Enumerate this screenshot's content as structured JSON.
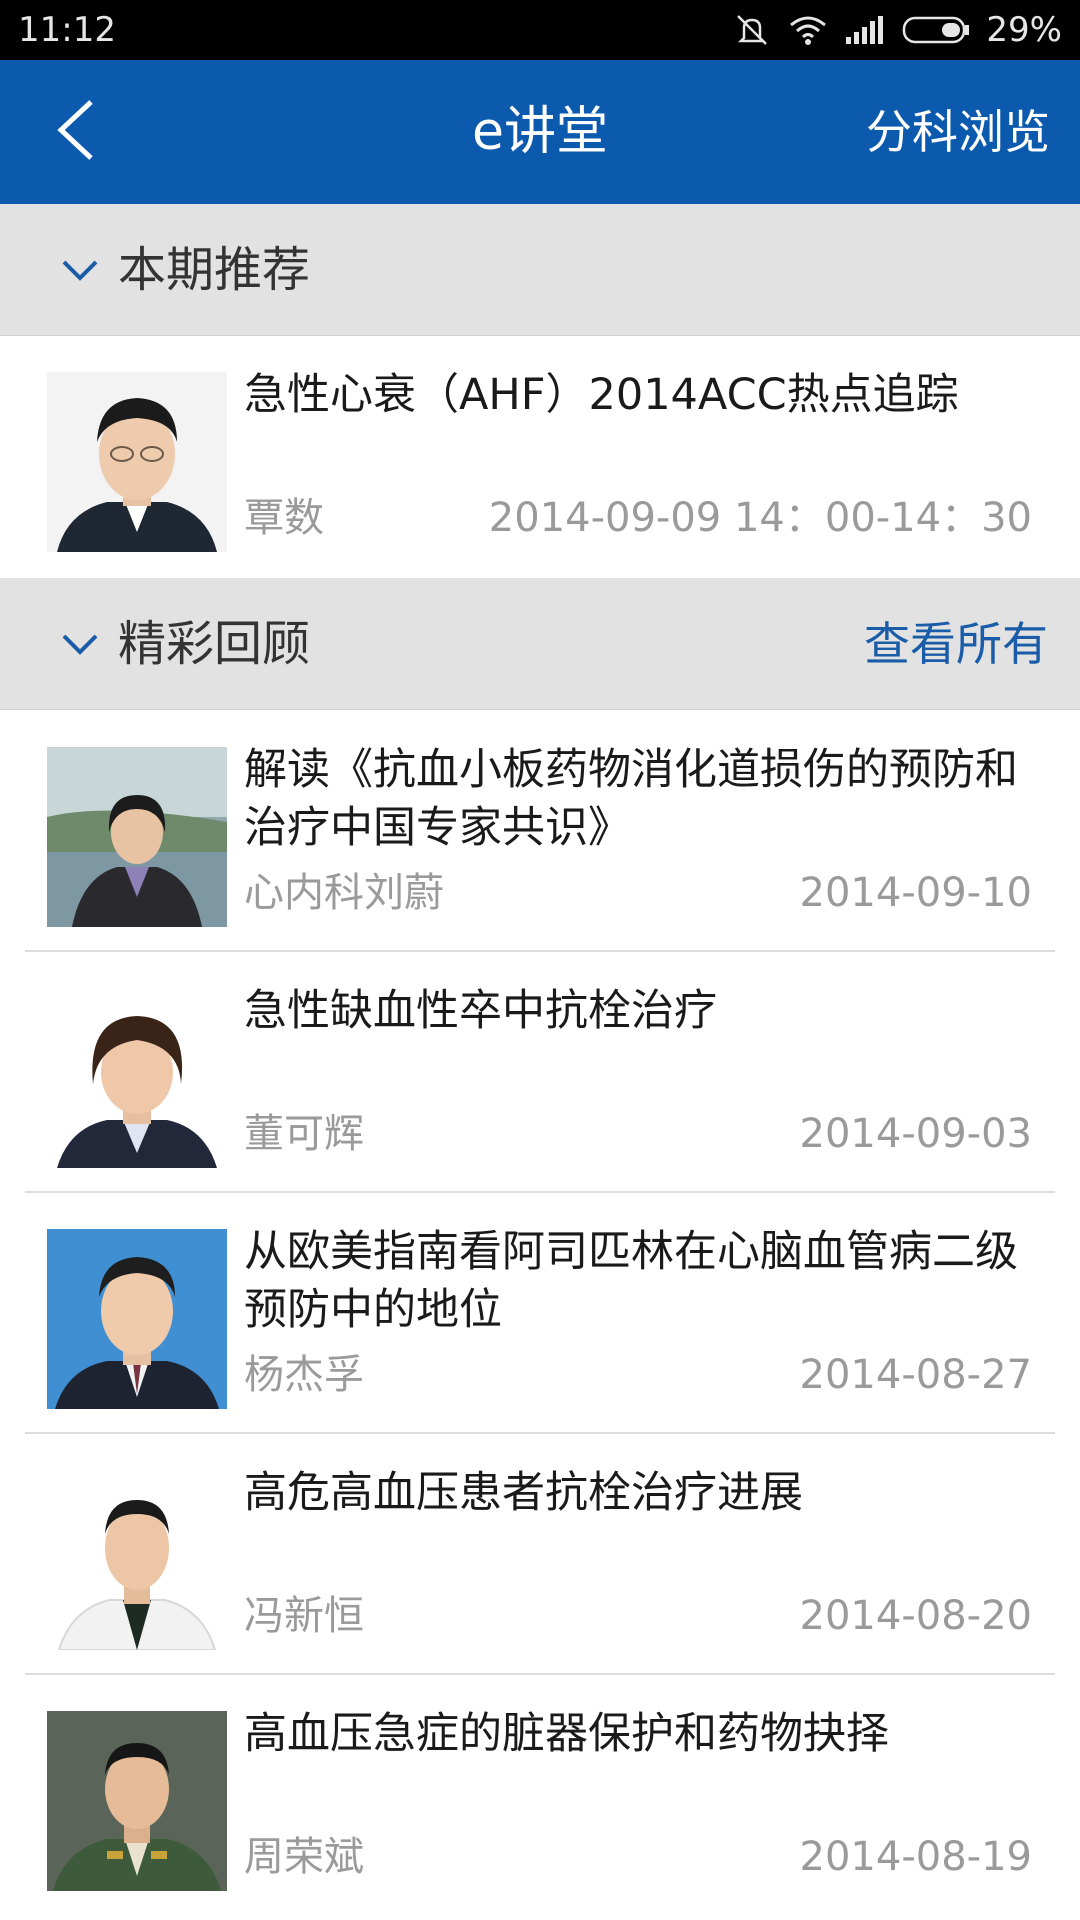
{
  "status_bar": {
    "time": "11:12",
    "battery": "29%",
    "icons": [
      "mute-icon",
      "wifi-icon",
      "signal-icon",
      "battery-icon"
    ]
  },
  "header": {
    "title": "e讲堂",
    "action": "分科浏览",
    "back_icon": "chevron-left-icon",
    "background": "#0c5aad"
  },
  "featured": {
    "section_title": "本期推荐",
    "item": {
      "title": "急性心衰（AHF）2014ACC热点追踪",
      "author": "覃数",
      "date": "2014-09-09 14：00-14：30"
    }
  },
  "review": {
    "section_title": "精彩回顾",
    "view_all": "查看所有",
    "items": [
      {
        "title": "解读《抗血小板药物消化道损伤的预防和治疗中国专家共识》",
        "author": "心内科刘蔚",
        "date": "2014-09-10"
      },
      {
        "title": "急性缺血性卒中抗栓治疗",
        "author": "董可辉",
        "date": "2014-09-03"
      },
      {
        "title": "从欧美指南看阿司匹林在心脑血管病二级预防中的地位",
        "author": "杨杰孚",
        "date": "2014-08-27"
      },
      {
        "title": "高危高血压患者抗栓治疗进展",
        "author": "冯新恒",
        "date": "2014-08-20"
      },
      {
        "title": "高血压急症的脏器保护和药物抉择",
        "author": "周荣斌",
        "date": "2014-08-19"
      }
    ]
  },
  "colors": {
    "accent": "#0c5aad",
    "link": "#1a5ca8",
    "section_bg": "#e2e2e2",
    "meta_text": "#9a9a9a"
  }
}
